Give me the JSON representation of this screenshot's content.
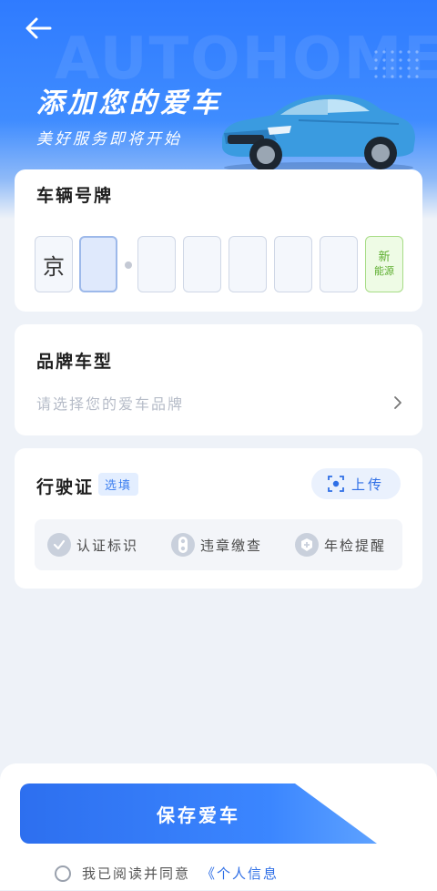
{
  "header": {
    "watermark": "AUTOHOME",
    "title": "添加您的爱车",
    "subtitle": "美好服务即将开始"
  },
  "plate": {
    "section_title": "车辆号牌",
    "province": "京",
    "new_energy_line1": "新",
    "new_energy_line2": "能源"
  },
  "brand": {
    "section_title": "品牌车型",
    "placeholder": "请选择您的爱车品牌"
  },
  "license": {
    "section_title": "行驶证",
    "optional_tag": "选填",
    "upload_label": "上传",
    "features": [
      {
        "label": "认证标识",
        "icon": "check-icon"
      },
      {
        "label": "违章缴查",
        "icon": "traffic-light-icon"
      },
      {
        "label": "年检提醒",
        "icon": "inspection-icon"
      }
    ]
  },
  "footer": {
    "save_label": "保存爱车",
    "agree_text": "我已阅读并同意",
    "agree_link": "《个人信息"
  },
  "colors": {
    "accent": "#2f7bff",
    "new_energy_green": "#5dae2f",
    "car_body": "#3a9be0"
  }
}
